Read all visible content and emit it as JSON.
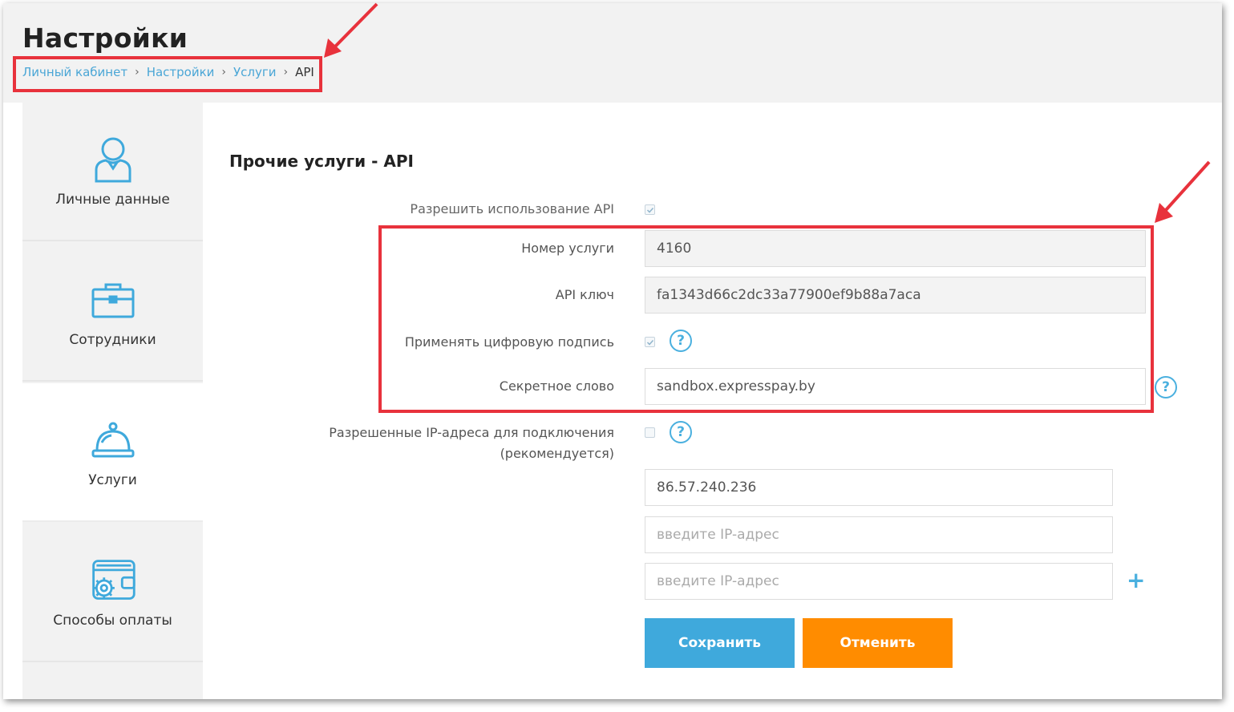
{
  "header": {
    "title": "Настройки",
    "breadcrumb": [
      "Личный кабинет",
      "Настройки",
      "Услуги",
      "API"
    ],
    "separator": "›"
  },
  "sidebar": {
    "items": [
      {
        "label": "Личные данные",
        "icon": "user-icon",
        "active": false
      },
      {
        "label": "Сотрудники",
        "icon": "briefcase-icon",
        "active": false
      },
      {
        "label": "Услуги",
        "icon": "service-bell-icon",
        "active": true
      },
      {
        "label": "Способы оплаты",
        "icon": "wallet-gear-icon",
        "active": false
      }
    ]
  },
  "main": {
    "section_title": "Прочие услуги - API",
    "fields": {
      "allow_api": {
        "label": "Разрешить использование API",
        "checked": true
      },
      "service_number": {
        "label": "Номер услуги",
        "value": "4160"
      },
      "api_key": {
        "label": "API ключ",
        "value": "fa1343d66c2dc33a77900ef9b88a7aca"
      },
      "digital_signature": {
        "label": "Применять цифровую подпись",
        "checked": true
      },
      "secret_word": {
        "label": "Секретное слово",
        "value": "sandbox.expresspay.by"
      },
      "allowed_ips": {
        "label_line1": "Разрешенные IP-адреса для подключения",
        "label_line2": "(рекомендуется)",
        "checked": false,
        "ip1_value": "86.57.240.236",
        "ip2_placeholder": "введите IP-адрес",
        "ip3_placeholder": "введите IP-адрес"
      }
    },
    "help_symbol": "?",
    "plus_symbol": "+",
    "buttons": {
      "save": "Сохранить",
      "cancel": "Отменить"
    }
  },
  "colors": {
    "accent": "#3fa9dc",
    "cancel": "#ff8c00",
    "annotation": "#e8323c"
  }
}
